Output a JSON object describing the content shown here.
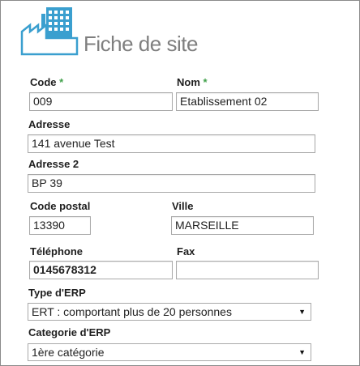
{
  "header": {
    "title": "Fiche de site",
    "icon": "factory-icon"
  },
  "form": {
    "code": {
      "label": "Code",
      "required_mark": "*",
      "value": "009"
    },
    "nom": {
      "label": "Nom",
      "required_mark": "*",
      "value": "Etablissement 02"
    },
    "adresse": {
      "label": "Adresse",
      "value": "141 avenue Test"
    },
    "adresse2": {
      "label": "Adresse 2",
      "value": "BP 39"
    },
    "code_postal": {
      "label": "Code postal",
      "value": "13390"
    },
    "ville": {
      "label": "Ville",
      "value": "MARSEILLE"
    },
    "telephone": {
      "label": "Téléphone",
      "value": "0145678312"
    },
    "fax": {
      "label": "Fax",
      "value": ""
    },
    "type_erp": {
      "label": "Type d'ERP",
      "selected": "ERT : comportant plus de 20 personnes"
    },
    "categorie_erp": {
      "label": "Categorie d'ERP",
      "selected": "1ère catégorie"
    }
  },
  "colors": {
    "icon_blue": "#3a9fcf",
    "title_gray": "#7f7f7f",
    "required_green": "#41a14b"
  }
}
